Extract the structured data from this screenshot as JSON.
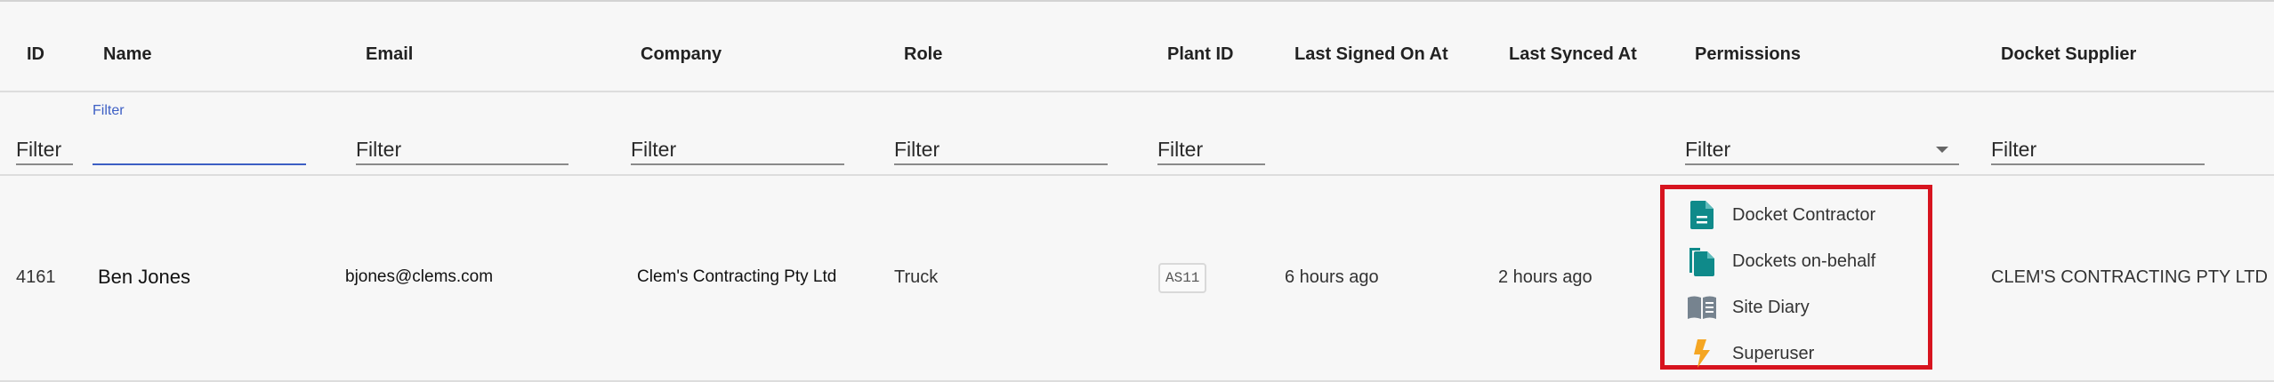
{
  "columns": {
    "id": "ID",
    "name": "Name",
    "email": "Email",
    "company": "Company",
    "role": "Role",
    "plant_id": "Plant ID",
    "last_signed_on": "Last Signed On At",
    "last_synced": "Last Synced At",
    "permissions": "Permissions",
    "docket_supplier": "Docket Supplier"
  },
  "filters": {
    "placeholder": "Filter",
    "focused_label": "Filter",
    "permissions_selected": "Filter"
  },
  "row": {
    "id": "4161",
    "name": "Ben Jones",
    "email": "bjones@clems.com",
    "company": "Clem's Contracting Pty Ltd",
    "role": "Truck",
    "plant_id": "AS11",
    "last_signed_on": "6 hours ago",
    "last_synced": "2 hours ago",
    "permissions": [
      {
        "label": "Docket Contractor",
        "icon": "docket-icon"
      },
      {
        "label": "Dockets on-behalf",
        "icon": "copy-docket-icon"
      },
      {
        "label": "Site Diary",
        "icon": "book-icon"
      },
      {
        "label": "Superuser",
        "icon": "lightning-icon"
      }
    ],
    "docket_supplier": "CLEM'S CONTRACTING PTY LTD"
  },
  "colors": {
    "accent_blue": "#3d5fc4",
    "highlight_red": "#d7141f",
    "teal_icon": "#0f8a8a",
    "grey_icon": "#76838f",
    "amber_icon": "#f5a623"
  }
}
